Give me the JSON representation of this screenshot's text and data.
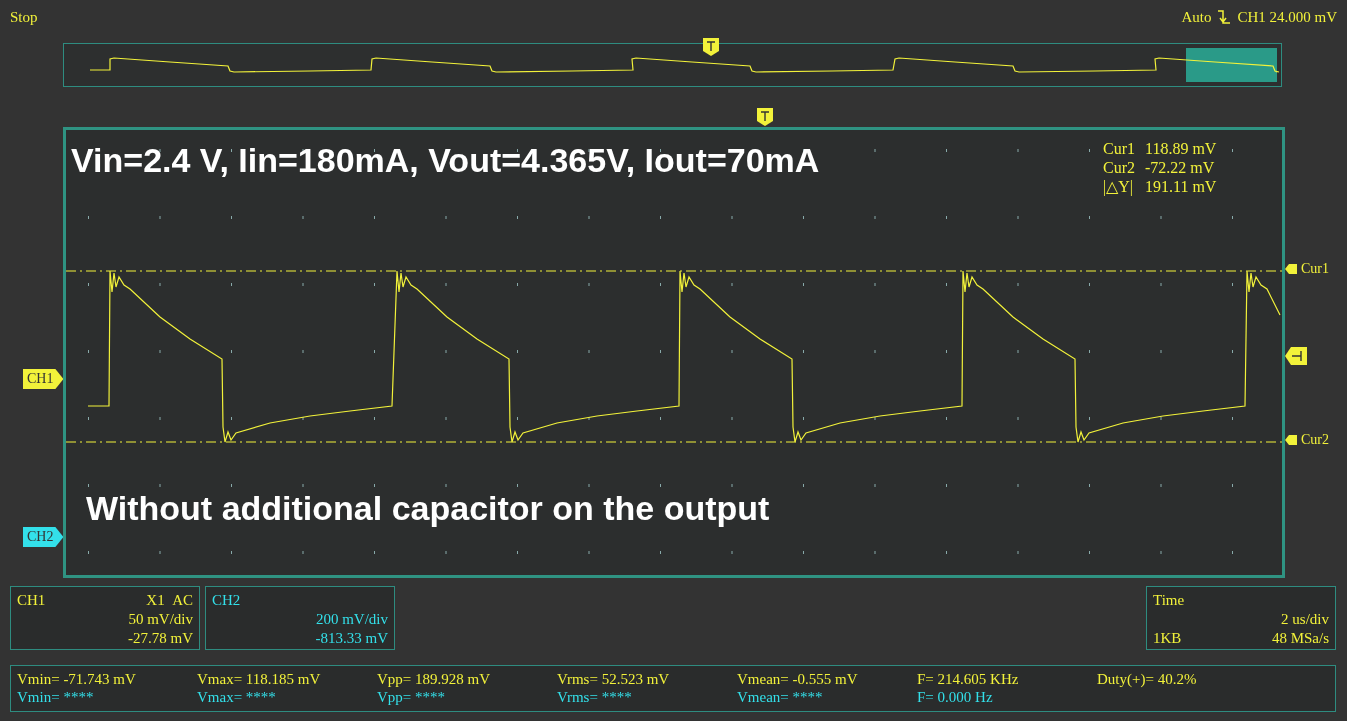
{
  "status": {
    "run_state": "Stop",
    "trigger_mode": "Auto",
    "trigger_readout": "CH1 24.000 mV"
  },
  "display": {
    "annotations": [
      "Vin=2.4 V, Iin=180mA, Vout=4.365V, Iout=70mA",
      "Without additional capacitor on the output"
    ],
    "cursor_readouts": [
      {
        "label": "Cur1",
        "value": "118.89 mV"
      },
      {
        "label": "Cur2",
        "value": "-72.22 mV"
      },
      {
        "label": "|△Y|",
        "value": "191.11 mV"
      }
    ],
    "channel_markers": [
      {
        "label": "CH1",
        "color": "#f2f23a"
      },
      {
        "label": "CH2",
        "color": "#33e0ea"
      }
    ],
    "cursor_markers": [
      {
        "label": "Cur1"
      },
      {
        "label": "Cur2"
      }
    ]
  },
  "channels": [
    {
      "name": "CH1",
      "probe": "X1",
      "coupling": "AC",
      "scale": "50 mV/div",
      "offset": "-27.78 mV",
      "color": "#f2f23a"
    },
    {
      "name": "CH2",
      "scale": "200 mV/div",
      "offset": "-813.33 mV",
      "color": "#33e0ea"
    }
  ],
  "timebase": {
    "title": "Time",
    "scale": "2 us/div",
    "memory_depth": "1KB",
    "sample_rate": "48 MSa/s"
  },
  "measurements": [
    {
      "color": "#f2f23a",
      "items": [
        "Vmin= -71.743 mV",
        "Vmax= 118.185 mV",
        "Vpp= 189.928 mV",
        "Vrms= 52.523 mV",
        "Vmean= -0.555 mV",
        "F= 214.605 KHz",
        "Duty(+)= 40.2%"
      ]
    },
    {
      "color": "#33e0ea",
      "items": [
        "Vmin= ****",
        "Vmax= ****",
        "Vpp= ****",
        "Vrms= ****",
        "Vmean= ****",
        "F= 0.000 Hz"
      ]
    }
  ]
}
